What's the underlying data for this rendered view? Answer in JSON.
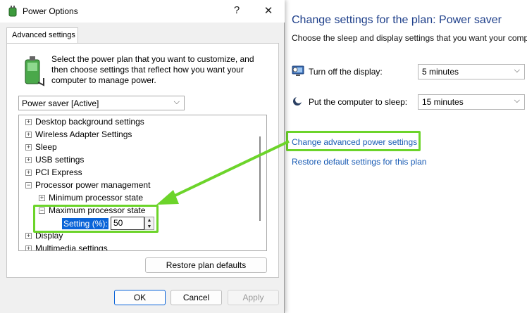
{
  "control_panel": {
    "title": "Change settings for the plan: Power saver",
    "subtitle": "Choose the sleep and display settings that you want your comp",
    "display_label": "Turn off the display:",
    "display_value": "5 minutes",
    "sleep_label": "Put the computer to sleep:",
    "sleep_value": "15 minutes",
    "advanced_link": "Change advanced power settings",
    "restore_link": "Restore default settings for this plan"
  },
  "dialog": {
    "title": "Power Options",
    "tab": "Advanced settings",
    "intro": "Select the power plan that you want to customize, and then choose settings that reflect how you want your computer to manage power.",
    "plan": "Power saver [Active]",
    "tree": [
      {
        "label": "Desktop background settings",
        "exp": "+"
      },
      {
        "label": "Wireless Adapter Settings",
        "exp": "+"
      },
      {
        "label": "Sleep",
        "exp": "+"
      },
      {
        "label": "USB settings",
        "exp": "+"
      },
      {
        "label": "PCI Express",
        "exp": "+"
      },
      {
        "label": "Processor power management",
        "exp": "−"
      },
      {
        "label": "Minimum processor state",
        "exp": "+"
      },
      {
        "label": "Maximum processor state",
        "exp": "−"
      },
      {
        "label": "Display",
        "exp": "+"
      },
      {
        "label": "Multimedia settings",
        "exp": "+"
      }
    ],
    "setting_label": "Setting (%):",
    "setting_value": "50",
    "restore_button": "Restore plan defaults",
    "ok": "OK",
    "cancel": "Cancel",
    "apply": "Apply"
  },
  "colors": {
    "highlight": "#6cd42a",
    "link": "#1a5cb4",
    "selection": "#0a64d8"
  }
}
